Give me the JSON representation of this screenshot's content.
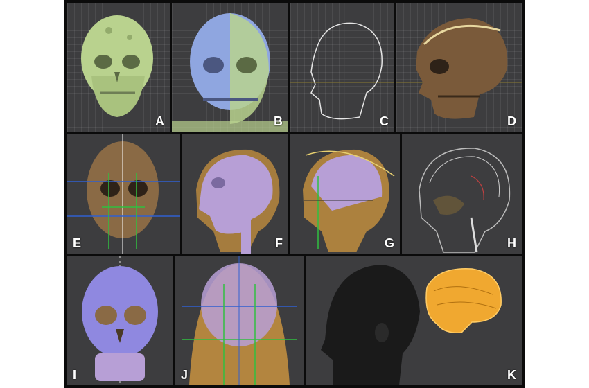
{
  "panels": [
    {
      "id": "A",
      "label": "A"
    },
    {
      "id": "B",
      "label": "B"
    },
    {
      "id": "C",
      "label": "C"
    },
    {
      "id": "D",
      "label": "D"
    },
    {
      "id": "E",
      "label": "E"
    },
    {
      "id": "F",
      "label": "F"
    },
    {
      "id": "G",
      "label": "G"
    },
    {
      "id": "H",
      "label": "H"
    },
    {
      "id": "I",
      "label": "I"
    },
    {
      "id": "J",
      "label": "J"
    },
    {
      "id": "K",
      "label": "K"
    }
  ],
  "colors": {
    "bone_green": "#b9d28e",
    "bone_blue": "#8fa6e0",
    "bone_brown": "#8a6a45",
    "skin_purple": "#b79fd6",
    "tissue_orange": "#c8923f",
    "brain_orange": "#f0a830",
    "background": "#3d3d3f"
  }
}
